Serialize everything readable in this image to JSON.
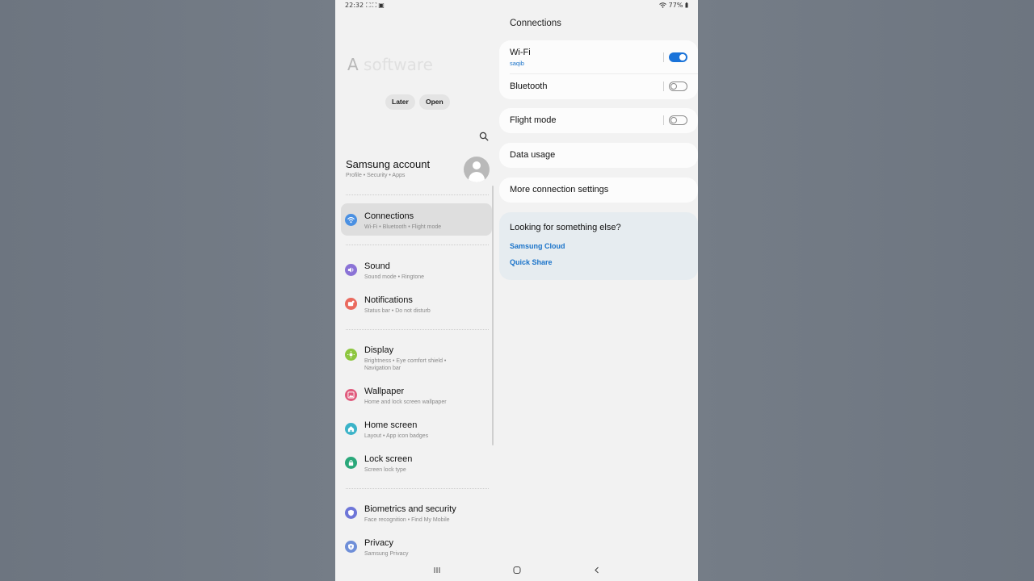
{
  "status_bar": {
    "time": "22:32",
    "notif_icons": [
      "screenshot-icon",
      "screenshot-icon",
      "media-icon"
    ],
    "battery": "77%"
  },
  "left_panel": {
    "app_title_prefix": "A",
    "app_title_ghost": "software",
    "later_label": "Later",
    "open_label": "Open",
    "account": {
      "title": "Samsung account",
      "subtitle": "Profile  •  Security  •  Apps"
    },
    "menu": [
      {
        "title": "Connections",
        "sub": "Wi-Fi  •  Bluetooth  •  Flight mode",
        "icon": "wifi-icon",
        "color": "#4a90e2",
        "active": true
      },
      {
        "title": "Sound",
        "sub": "Sound mode  •  Ringtone",
        "icon": "speaker-icon",
        "color": "#8b73d6",
        "active": false
      },
      {
        "title": "Notifications",
        "sub": "Status bar  •  Do not disturb",
        "icon": "bell-icon",
        "color": "#ea6a5e",
        "active": false
      },
      {
        "title": "Display",
        "sub": "Brightness  •  Eye comfort shield  •",
        "sub2": "Navigation bar",
        "icon": "sun-icon",
        "color": "#8dc63f",
        "active": false
      },
      {
        "title": "Wallpaper",
        "sub": "Home and lock screen wallpaper",
        "icon": "image-icon",
        "color": "#e05b7d",
        "active": false
      },
      {
        "title": "Home screen",
        "sub": "Layout  •  App icon badges",
        "icon": "home-icon",
        "color": "#3bb3c8",
        "active": false
      },
      {
        "title": "Lock screen",
        "sub": "Screen lock type",
        "icon": "lock-icon",
        "color": "#2aa87a",
        "active": false
      },
      {
        "title": "Biometrics and security",
        "sub": "Face recognition  •  Find My Mobile",
        "icon": "shield-icon",
        "color": "#6e76d8",
        "active": false
      },
      {
        "title": "Privacy",
        "sub": "Samsung Privacy",
        "icon": "privacy-icon",
        "color": "#6f8fd8",
        "active": false
      }
    ]
  },
  "right_panel": {
    "title": "Connections",
    "wifi": {
      "title": "Wi-Fi",
      "sub": "saqib",
      "on": true
    },
    "bluetooth": {
      "title": "Bluetooth",
      "on": false
    },
    "flight_mode": {
      "title": "Flight mode",
      "on": false
    },
    "data_usage": {
      "title": "Data usage"
    },
    "more_settings": {
      "title": "More connection settings"
    },
    "suggest": {
      "title": "Looking for something else?",
      "links": [
        "Samsung Cloud",
        "Quick Share"
      ]
    }
  },
  "colors": {
    "accent": "#1a73d9",
    "link": "#1a73c9",
    "screen_bg": "#f2f2f2",
    "card_bg": "#fcfcfc"
  }
}
